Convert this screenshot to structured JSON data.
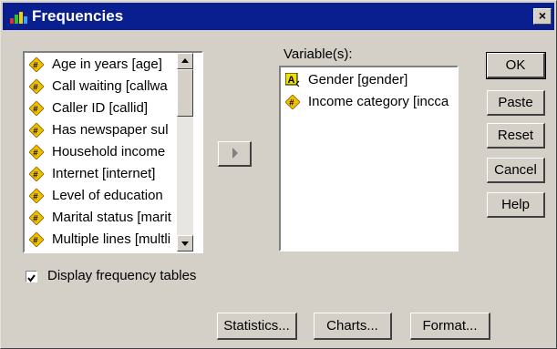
{
  "window": {
    "title": "Frequencies",
    "close_label": "×"
  },
  "source_list": {
    "items": [
      {
        "label": "Age in years [age]",
        "icon": "scale-variable-icon"
      },
      {
        "label": "Call waiting [callwa",
        "icon": "scale-variable-icon"
      },
      {
        "label": "Caller ID [callid]",
        "icon": "scale-variable-icon"
      },
      {
        "label": "Has newspaper sul",
        "icon": "scale-variable-icon"
      },
      {
        "label": "Household income",
        "icon": "scale-variable-icon"
      },
      {
        "label": "Internet [internet]",
        "icon": "scale-variable-icon"
      },
      {
        "label": "Level of education",
        "icon": "scale-variable-icon"
      },
      {
        "label": "Marital status [marit",
        "icon": "scale-variable-icon"
      },
      {
        "label": "Multiple lines [multli",
        "icon": "scale-variable-icon"
      }
    ]
  },
  "variables": {
    "heading": "Variable(s):",
    "items": [
      {
        "label": "Gender [gender]",
        "icon": "string-variable-icon"
      },
      {
        "label": "Income category [incca",
        "icon": "scale-variable-icon"
      }
    ]
  },
  "buttons": {
    "ok": "OK",
    "paste": "Paste",
    "reset": "Reset",
    "cancel": "Cancel",
    "help": "Help",
    "statistics": "Statistics...",
    "charts": "Charts...",
    "format": "Format..."
  },
  "display_tables": {
    "label": "Display frequency tables",
    "checked": true
  },
  "colors": {
    "titlebar": "#0a1f8f",
    "dialog": "#d4d0c8",
    "scale_icon": "#f0c000"
  }
}
